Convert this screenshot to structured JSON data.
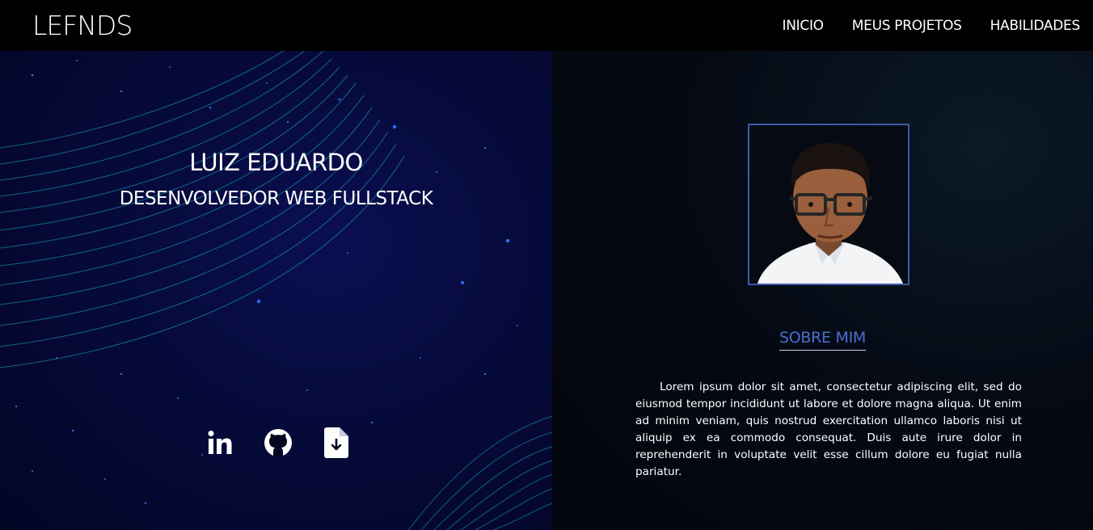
{
  "header": {
    "logo": "LEFNDS",
    "nav": [
      "INICIO",
      "MEUS PROJETOS",
      "HABILIDADES"
    ]
  },
  "hero": {
    "name": "LUIZ EDUARDO",
    "role": "DESENVOLVEDOR WEB FULLSTACK",
    "socials": [
      "linkedin-icon",
      "github-icon",
      "download-file-icon"
    ]
  },
  "about": {
    "title": "SOBRE MIM",
    "text": "Lorem ipsum dolor sit amet, consectetur adipiscing elit, sed do eiusmod tempor incididunt ut labore et dolore magna aliqua. Ut enim ad minim veniam, quis nostrud exercitation ullamco laboris nisi ut aliquip ex ea commodo consequat. Duis aute irure dolor in reprehenderit in voluptate velit esse cillum dolore eu fugiat nulla pariatur."
  },
  "colors": {
    "accent": "#4d6fd0",
    "photo_border": "#3c5aa8",
    "wave": "#1aa7b8"
  }
}
